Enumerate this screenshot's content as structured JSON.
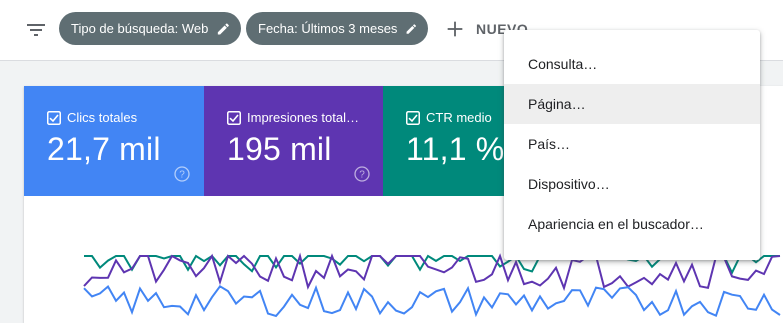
{
  "filter_bar": {
    "icon": "filter-list-icon",
    "chips": [
      {
        "label": "Tipo de búsqueda: Web",
        "icon": "pencil-icon"
      },
      {
        "label": "Fecha: Últimos 3 meses",
        "icon": "pencil-icon"
      }
    ],
    "new_button": {
      "label": "NUEVO",
      "icon": "plus-icon"
    }
  },
  "metrics": [
    {
      "label": "Clics totales",
      "value": "21,7 mil",
      "color": "#4285f4",
      "checked": true,
      "icon": "help-icon"
    },
    {
      "label": "Impresiones total…",
      "value": "195 mil",
      "color": "#5e35b1",
      "checked": true,
      "icon": "help-icon"
    },
    {
      "label": "CTR medio",
      "value": "11,1 %",
      "color": "#00897b",
      "checked": true
    }
  ],
  "dropdown_menu": {
    "items": [
      "Consulta…",
      "Página…",
      "País…",
      "Dispositivo…",
      "Apariencia en el buscador…"
    ],
    "highlighted_index": 1
  },
  "colors": {
    "chip_bg": "#5f6e73",
    "menu_hover": "#eeeeee",
    "page_bg": "#f1f3f4"
  }
}
